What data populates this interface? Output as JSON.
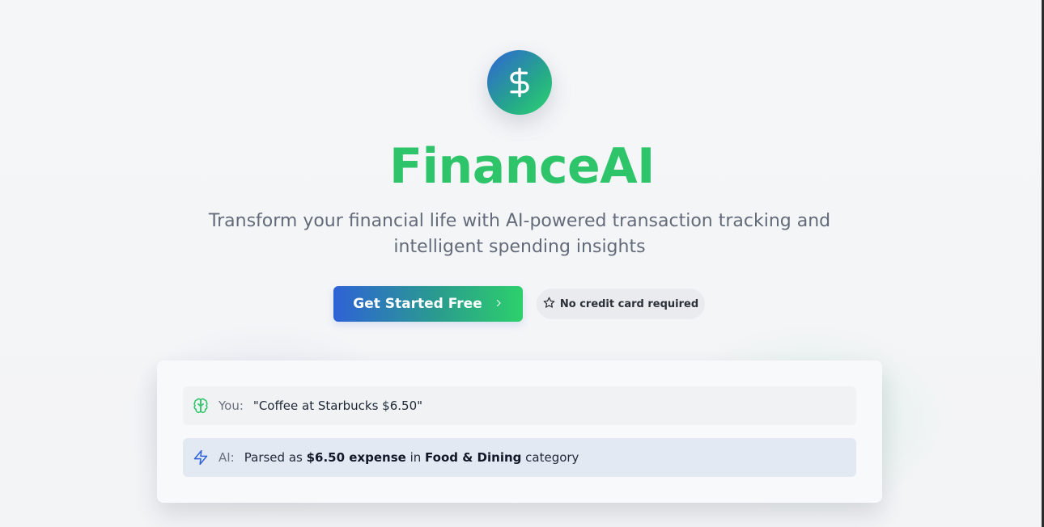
{
  "brand": {
    "logo_icon": "dollar-icon",
    "title": "FinanceAI",
    "subtitle": "Transform your financial life with AI-powered transaction tracking and intelligent spending insights"
  },
  "cta": {
    "label": "Get Started Free",
    "icon": "chevron-right-icon"
  },
  "badge": {
    "icon": "star-icon",
    "label": "No credit card required"
  },
  "demo": {
    "user": {
      "icon": "brain-icon",
      "who": "You:",
      "message": "\"Coffee at Starbucks $6.50\""
    },
    "ai": {
      "icon": "bolt-icon",
      "who": "AI:",
      "prefix": "Parsed as ",
      "amount": "$6.50 expense",
      "middle": " in ",
      "category": "Food & Dining",
      "suffix": " category"
    }
  },
  "colors": {
    "brand_green": "#2ec46a",
    "brand_blue": "#2e62d6",
    "subtitle": "#636b7a"
  }
}
